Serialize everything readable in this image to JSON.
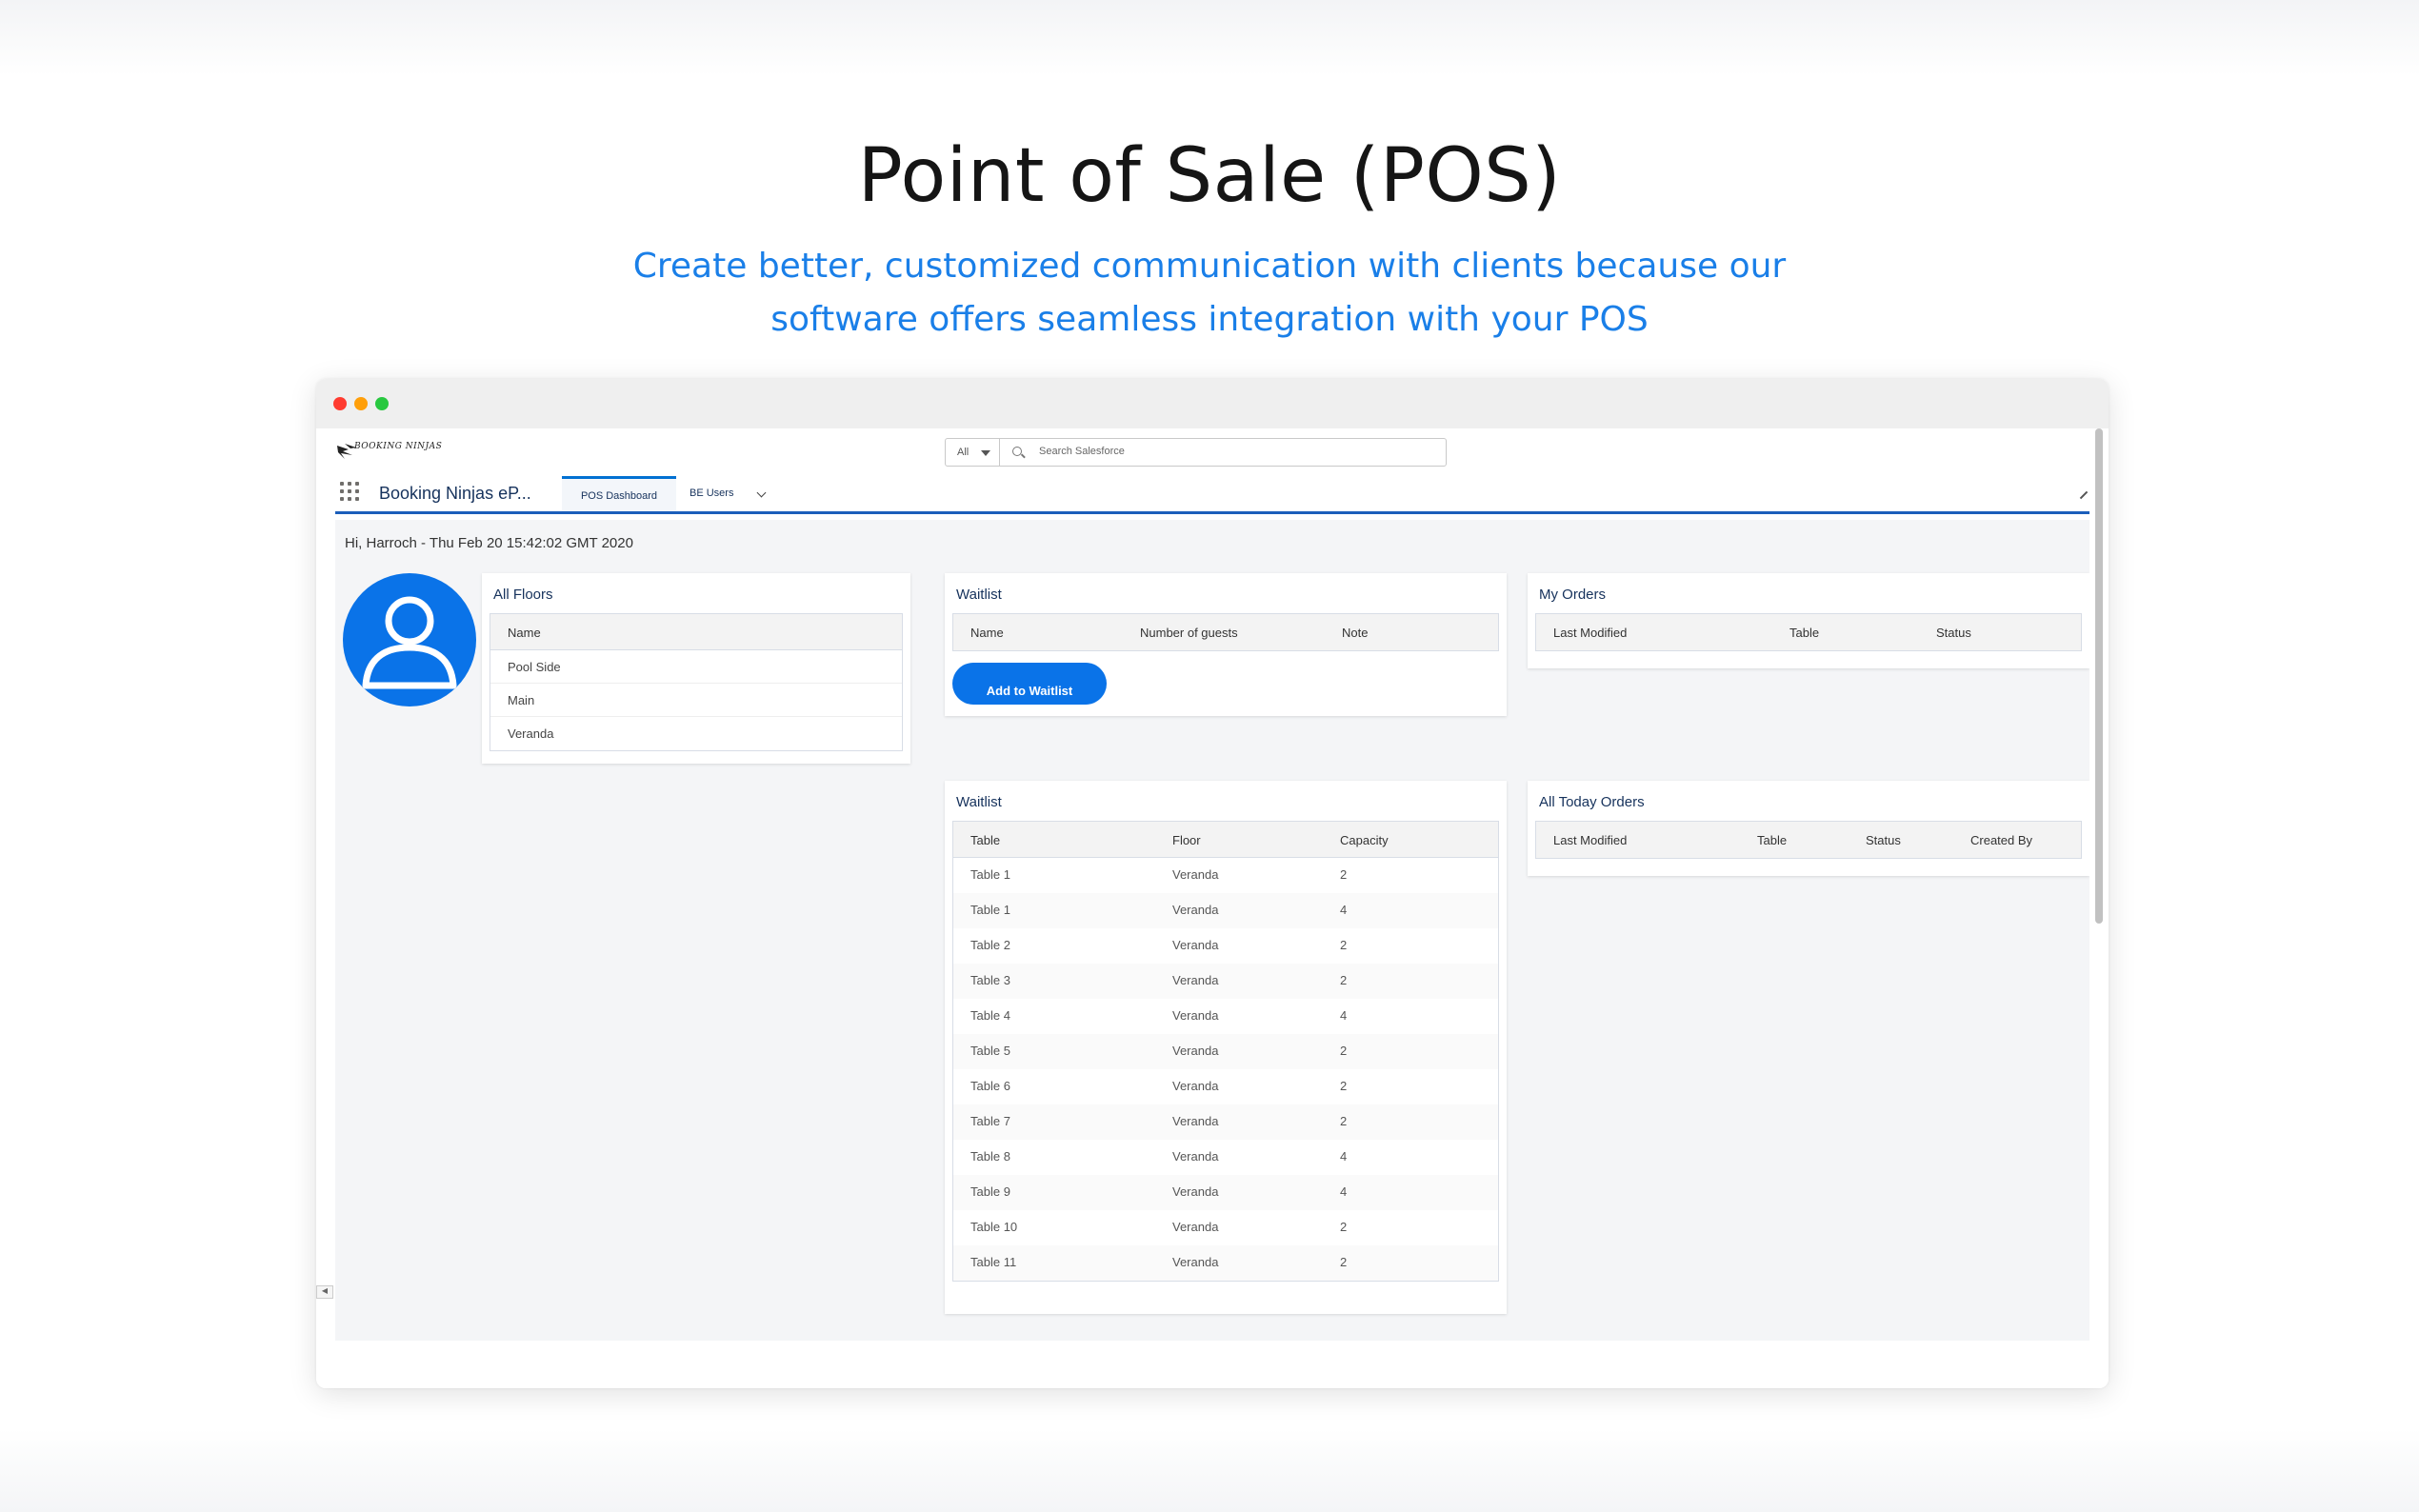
{
  "hero": {
    "title": "Point of Sale (POS)",
    "subtitle_line1": "Create better, customized communication with clients because our",
    "subtitle_line2": "software offers seamless integration with your POS"
  },
  "header": {
    "logo_text": "BOOKING NINJAS",
    "search_scope": "All",
    "search_placeholder": "Search Salesforce",
    "app_name": "Booking Ninjas eP...",
    "tabs": [
      {
        "label": "POS Dashboard",
        "active": true
      },
      {
        "label": "BE Users",
        "active": false
      }
    ]
  },
  "greeting": "Hi, Harroch - Thu Feb 20 15:42:02 GMT 2020",
  "all_floors": {
    "title": "All Floors",
    "column": "Name",
    "rows": [
      "Pool Side",
      "Main",
      "Veranda"
    ]
  },
  "waitlist_top": {
    "title": "Waitlist",
    "columns": [
      "Name",
      "Number of guests",
      "Note"
    ],
    "button": "Add to Waitlist"
  },
  "my_orders": {
    "title": "My Orders",
    "columns": [
      "Last Modified",
      "Table",
      "Status"
    ]
  },
  "waitlist_tables": {
    "title": "Waitlist",
    "columns": [
      "Table",
      "Floor",
      "Capacity"
    ],
    "rows": [
      [
        "Table 1",
        "Veranda",
        "2"
      ],
      [
        "Table 1",
        "Veranda",
        "4"
      ],
      [
        "Table 2",
        "Veranda",
        "2"
      ],
      [
        "Table 3",
        "Veranda",
        "2"
      ],
      [
        "Table 4",
        "Veranda",
        "4"
      ],
      [
        "Table 5",
        "Veranda",
        "2"
      ],
      [
        "Table 6",
        "Veranda",
        "2"
      ],
      [
        "Table 7",
        "Veranda",
        "2"
      ],
      [
        "Table 8",
        "Veranda",
        "4"
      ],
      [
        "Table 9",
        "Veranda",
        "4"
      ],
      [
        "Table 10",
        "Veranda",
        "2"
      ],
      [
        "Table 11",
        "Veranda",
        "2"
      ]
    ]
  },
  "all_today_orders": {
    "title": "All Today Orders",
    "columns": [
      "Last Modified",
      "Table",
      "Status",
      "Created By"
    ]
  },
  "colors": {
    "accent": "#0a73e8",
    "subtitle": "#1a7fe8",
    "nav_line": "#1b5eba"
  }
}
